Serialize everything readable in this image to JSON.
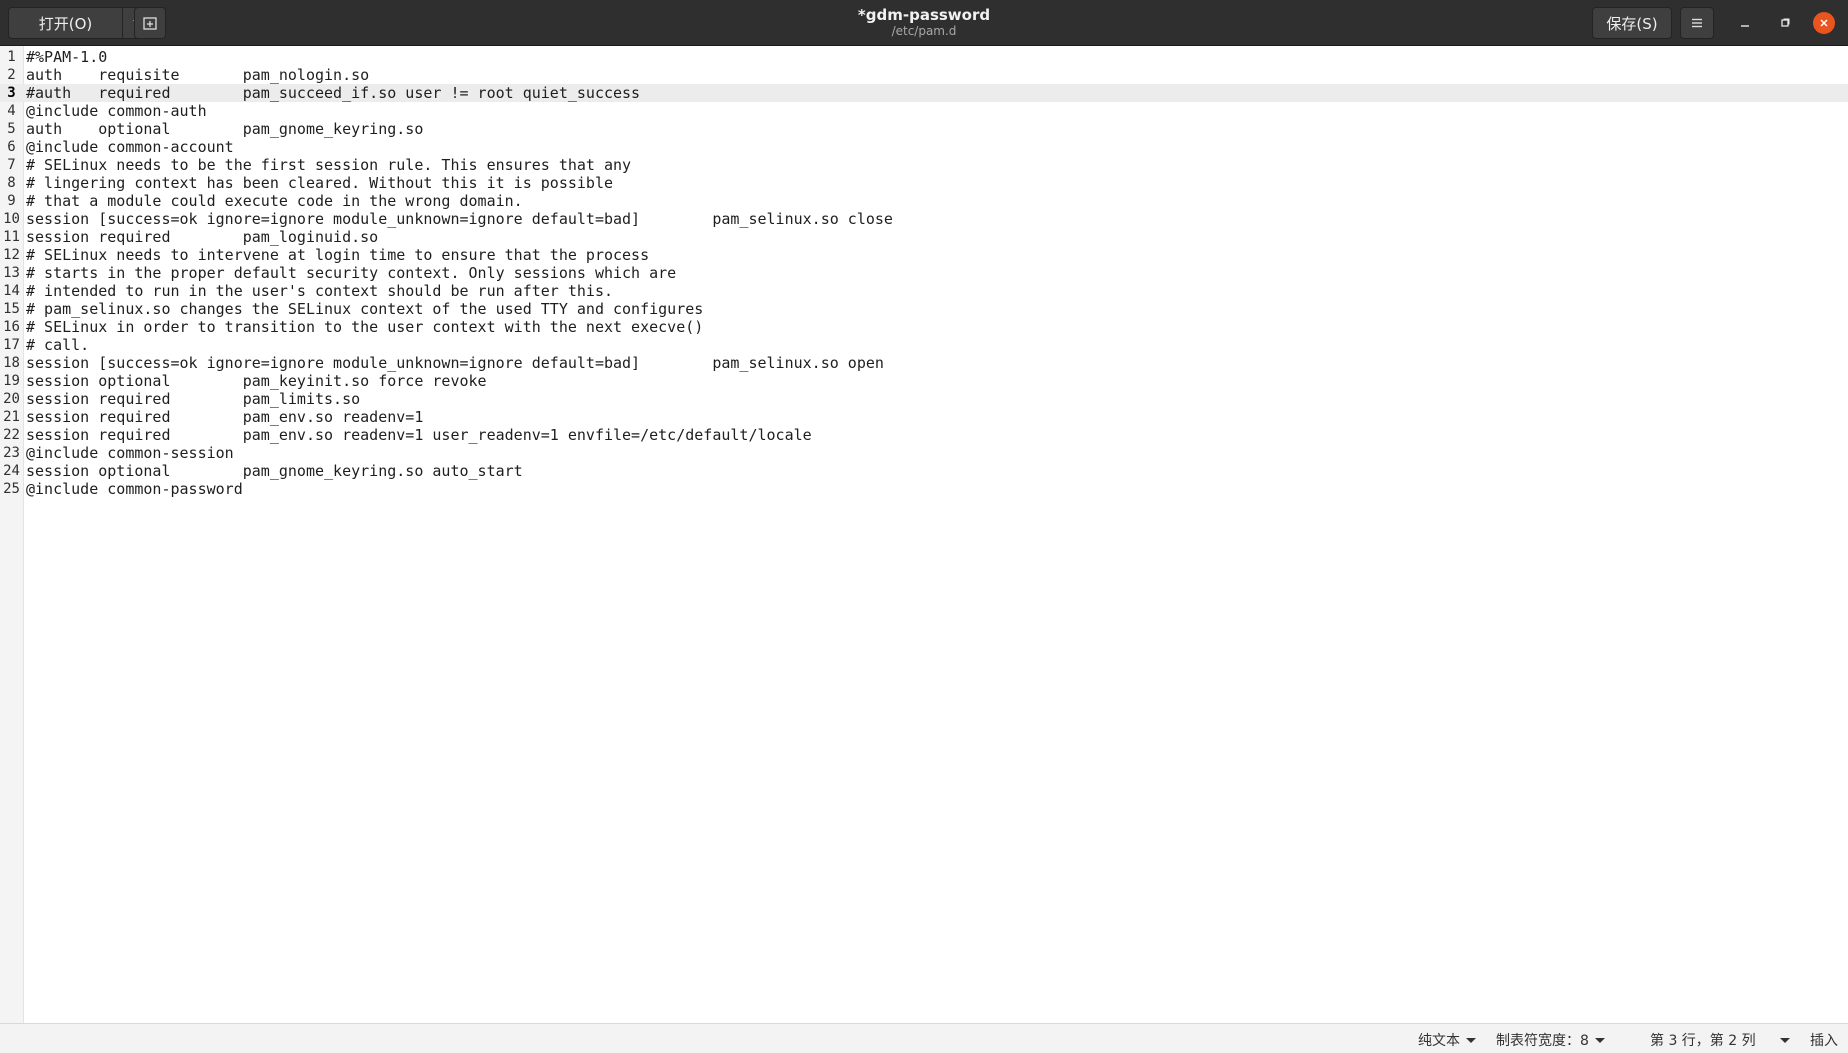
{
  "header": {
    "title": "*gdm-password",
    "subtitle": "/etc/pam.d",
    "open_label": "打开(O)",
    "save_label": "保存(S)"
  },
  "editor": {
    "current_line": 3,
    "lines": [
      {
        "n": "1",
        "text": "#%PAM-1.0"
      },
      {
        "n": "2",
        "text": "auth    requisite       pam_nologin.so"
      },
      {
        "n": "3",
        "text": "#auth   required        pam_succeed_if.so user != root quiet_success"
      },
      {
        "n": "4",
        "text": "@include common-auth"
      },
      {
        "n": "5",
        "text": "auth    optional        pam_gnome_keyring.so"
      },
      {
        "n": "6",
        "text": "@include common-account"
      },
      {
        "n": "7",
        "text": "# SELinux needs to be the first session rule. This ensures that any"
      },
      {
        "n": "8",
        "text": "# lingering context has been cleared. Without this it is possible"
      },
      {
        "n": "9",
        "text": "# that a module could execute code in the wrong domain."
      },
      {
        "n": "10",
        "text": "session [success=ok ignore=ignore module_unknown=ignore default=bad]        pam_selinux.so close"
      },
      {
        "n": "11",
        "text": "session required        pam_loginuid.so"
      },
      {
        "n": "12",
        "text": "# SELinux needs to intervene at login time to ensure that the process"
      },
      {
        "n": "13",
        "text": "# starts in the proper default security context. Only sessions which are"
      },
      {
        "n": "14",
        "text": "# intended to run in the user's context should be run after this."
      },
      {
        "n": "15",
        "text": "# pam_selinux.so changes the SELinux context of the used TTY and configures"
      },
      {
        "n": "16",
        "text": "# SELinux in order to transition to the user context with the next execve()"
      },
      {
        "n": "17",
        "text": "# call."
      },
      {
        "n": "18",
        "text": "session [success=ok ignore=ignore module_unknown=ignore default=bad]        pam_selinux.so open"
      },
      {
        "n": "19",
        "text": "session optional        pam_keyinit.so force revoke"
      },
      {
        "n": "20",
        "text": "session required        pam_limits.so"
      },
      {
        "n": "21",
        "text": "session required        pam_env.so readenv=1"
      },
      {
        "n": "22",
        "text": "session required        pam_env.so readenv=1 user_readenv=1 envfile=/etc/default/locale"
      },
      {
        "n": "23",
        "text": "@include common-session"
      },
      {
        "n": "24",
        "text": "session optional        pam_gnome_keyring.so auto_start"
      },
      {
        "n": "25",
        "text": "@include common-password"
      }
    ]
  },
  "statusbar": {
    "language": "纯文本",
    "tab_width": "制表符宽度：8",
    "position": "第 3 行，第 2 列",
    "mode": "插入"
  }
}
